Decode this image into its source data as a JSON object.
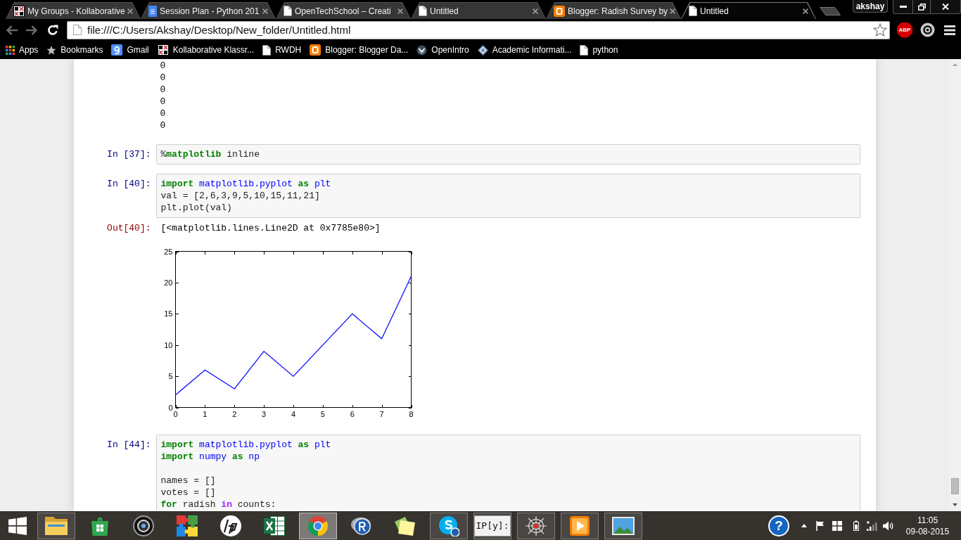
{
  "browser": {
    "tabs": [
      {
        "title": "My Groups - Kollaborative",
        "kind": "kk",
        "selected": false
      },
      {
        "title": "Session Plan - Python 201",
        "kind": "doc",
        "selected": false
      },
      {
        "title": "OpenTechSchool – Creati",
        "kind": "page",
        "selected": false
      },
      {
        "title": "Untitled",
        "kind": "page",
        "selected": false
      },
      {
        "title": "Blogger: Radish Survey by",
        "kind": "blogger",
        "selected": false
      },
      {
        "title": "Untitled",
        "kind": "page",
        "selected": true
      }
    ],
    "profile": "akshay",
    "address": "file:///C:/Users/Akshay/Desktop/New_folder/Untitled.html",
    "extensions": [
      {
        "kind": "abp",
        "label": "ABP"
      },
      {
        "kind": "ring"
      }
    ],
    "bookmarks": [
      {
        "label": "Apps",
        "kind": "apps"
      },
      {
        "label": "Bookmarks",
        "kind": "star"
      },
      {
        "label": "Gmail",
        "kind": "gplus"
      },
      {
        "label": "Kollaborative Klassr...",
        "kind": "kk"
      },
      {
        "label": "RWDH",
        "kind": "page"
      },
      {
        "label": "Blogger: Blogger Da...",
        "kind": "blogger"
      },
      {
        "label": "OpenIntro",
        "kind": "openintro"
      },
      {
        "label": "Academic Informati...",
        "kind": "diamond"
      },
      {
        "label": "python",
        "kind": "page"
      }
    ]
  },
  "notebook": {
    "cells": [
      {
        "kind": "stream",
        "lines": [
          "0",
          "0",
          "0",
          "0",
          "0",
          "0"
        ]
      },
      {
        "kind": "code",
        "prompt": "In [37]:",
        "lines": [
          {
            "kind": "code",
            "tokens": [
              {
                "text": "%",
                "kind": "plain"
              },
              {
                "text": "matplotlib",
                "kind": "keyword"
              },
              {
                "text": " inline",
                "kind": "plain"
              }
            ]
          }
        ]
      },
      {
        "kind": "code",
        "prompt": "In [40]:",
        "lines": [
          {
            "kind": "code",
            "tokens": [
              {
                "text": "import",
                "kind": "keyword"
              },
              {
                "text": " matplotlib.pyplot ",
                "kind": "module"
              },
              {
                "text": "as",
                "kind": "keyword"
              },
              {
                "text": " plt",
                "kind": "module"
              }
            ]
          },
          {
            "kind": "code",
            "tokens": [
              {
                "text": "val = [2,6,3,9,5,10,15,11,21]",
                "kind": "plain"
              }
            ]
          },
          {
            "kind": "code",
            "tokens": [
              {
                "text": "plt.plot(val)",
                "kind": "plain"
              }
            ]
          }
        ]
      },
      {
        "kind": "result",
        "prompt": "Out[40]:",
        "text": "[<matplotlib.lines.Line2D at 0x7785e80>]"
      },
      {
        "kind": "plot",
        "chart_data": {
          "type": "line",
          "x": [
            0,
            1,
            2,
            3,
            4,
            5,
            6,
            7,
            8
          ],
          "values": [
            2,
            6,
            3,
            9,
            5,
            10,
            15,
            11,
            21
          ],
          "color": "#0000ff",
          "xlim": [
            0,
            8
          ],
          "ylim": [
            0,
            25
          ],
          "xticks": [
            0,
            1,
            2,
            3,
            4,
            5,
            6,
            7,
            8
          ],
          "yticks": [
            0,
            5,
            10,
            15,
            20,
            25
          ]
        }
      },
      {
        "kind": "code",
        "prompt": "In [44]:",
        "lines": [
          {
            "kind": "code",
            "tokens": [
              {
                "text": "import",
                "kind": "keyword"
              },
              {
                "text": " matplotlib.pyplot ",
                "kind": "module"
              },
              {
                "text": "as",
                "kind": "keyword"
              },
              {
                "text": " plt",
                "kind": "module"
              }
            ]
          },
          {
            "kind": "code",
            "tokens": [
              {
                "text": "import",
                "kind": "keyword"
              },
              {
                "text": " numpy ",
                "kind": "module"
              },
              {
                "text": "as",
                "kind": "keyword"
              },
              {
                "text": " np",
                "kind": "module"
              }
            ]
          },
          {
            "kind": "blank"
          },
          {
            "kind": "code",
            "tokens": [
              {
                "text": "names = []",
                "kind": "plain"
              }
            ]
          },
          {
            "kind": "code",
            "tokens": [
              {
                "text": "votes = []",
                "kind": "plain"
              }
            ]
          },
          {
            "kind": "code",
            "tokens": [
              {
                "text": "for",
                "kind": "keyword"
              },
              {
                "text": " radish ",
                "kind": "plain"
              },
              {
                "text": "in",
                "kind": "operator"
              },
              {
                "text": " counts:",
                "kind": "plain"
              }
            ]
          }
        ]
      }
    ]
  },
  "taskbar": {
    "apps": [
      {
        "kind": "explorer",
        "running": true,
        "selected": false
      },
      {
        "kind": "store",
        "running": false,
        "selected": false
      },
      {
        "kind": "webcam",
        "running": false,
        "selected": false
      },
      {
        "kind": "puzzle",
        "running": false,
        "selected": false
      },
      {
        "kind": "hp",
        "running": false,
        "selected": false
      },
      {
        "kind": "excel",
        "running": false,
        "selected": false
      },
      {
        "kind": "chrome",
        "running": true,
        "selected": true
      },
      {
        "kind": "r",
        "running": false,
        "selected": false
      },
      {
        "kind": "notes",
        "running": false,
        "selected": false
      },
      {
        "kind": "skype",
        "running": true,
        "selected": false
      },
      {
        "kind": "ipython",
        "label": "IP[y]:",
        "running": true,
        "selected": false
      },
      {
        "kind": "spider",
        "running": true,
        "selected": false
      },
      {
        "kind": "media",
        "running": true,
        "selected": false
      },
      {
        "kind": "photos",
        "running": true,
        "selected": false
      }
    ],
    "help": "?",
    "time": "11:05",
    "date": "09-08-2015"
  }
}
